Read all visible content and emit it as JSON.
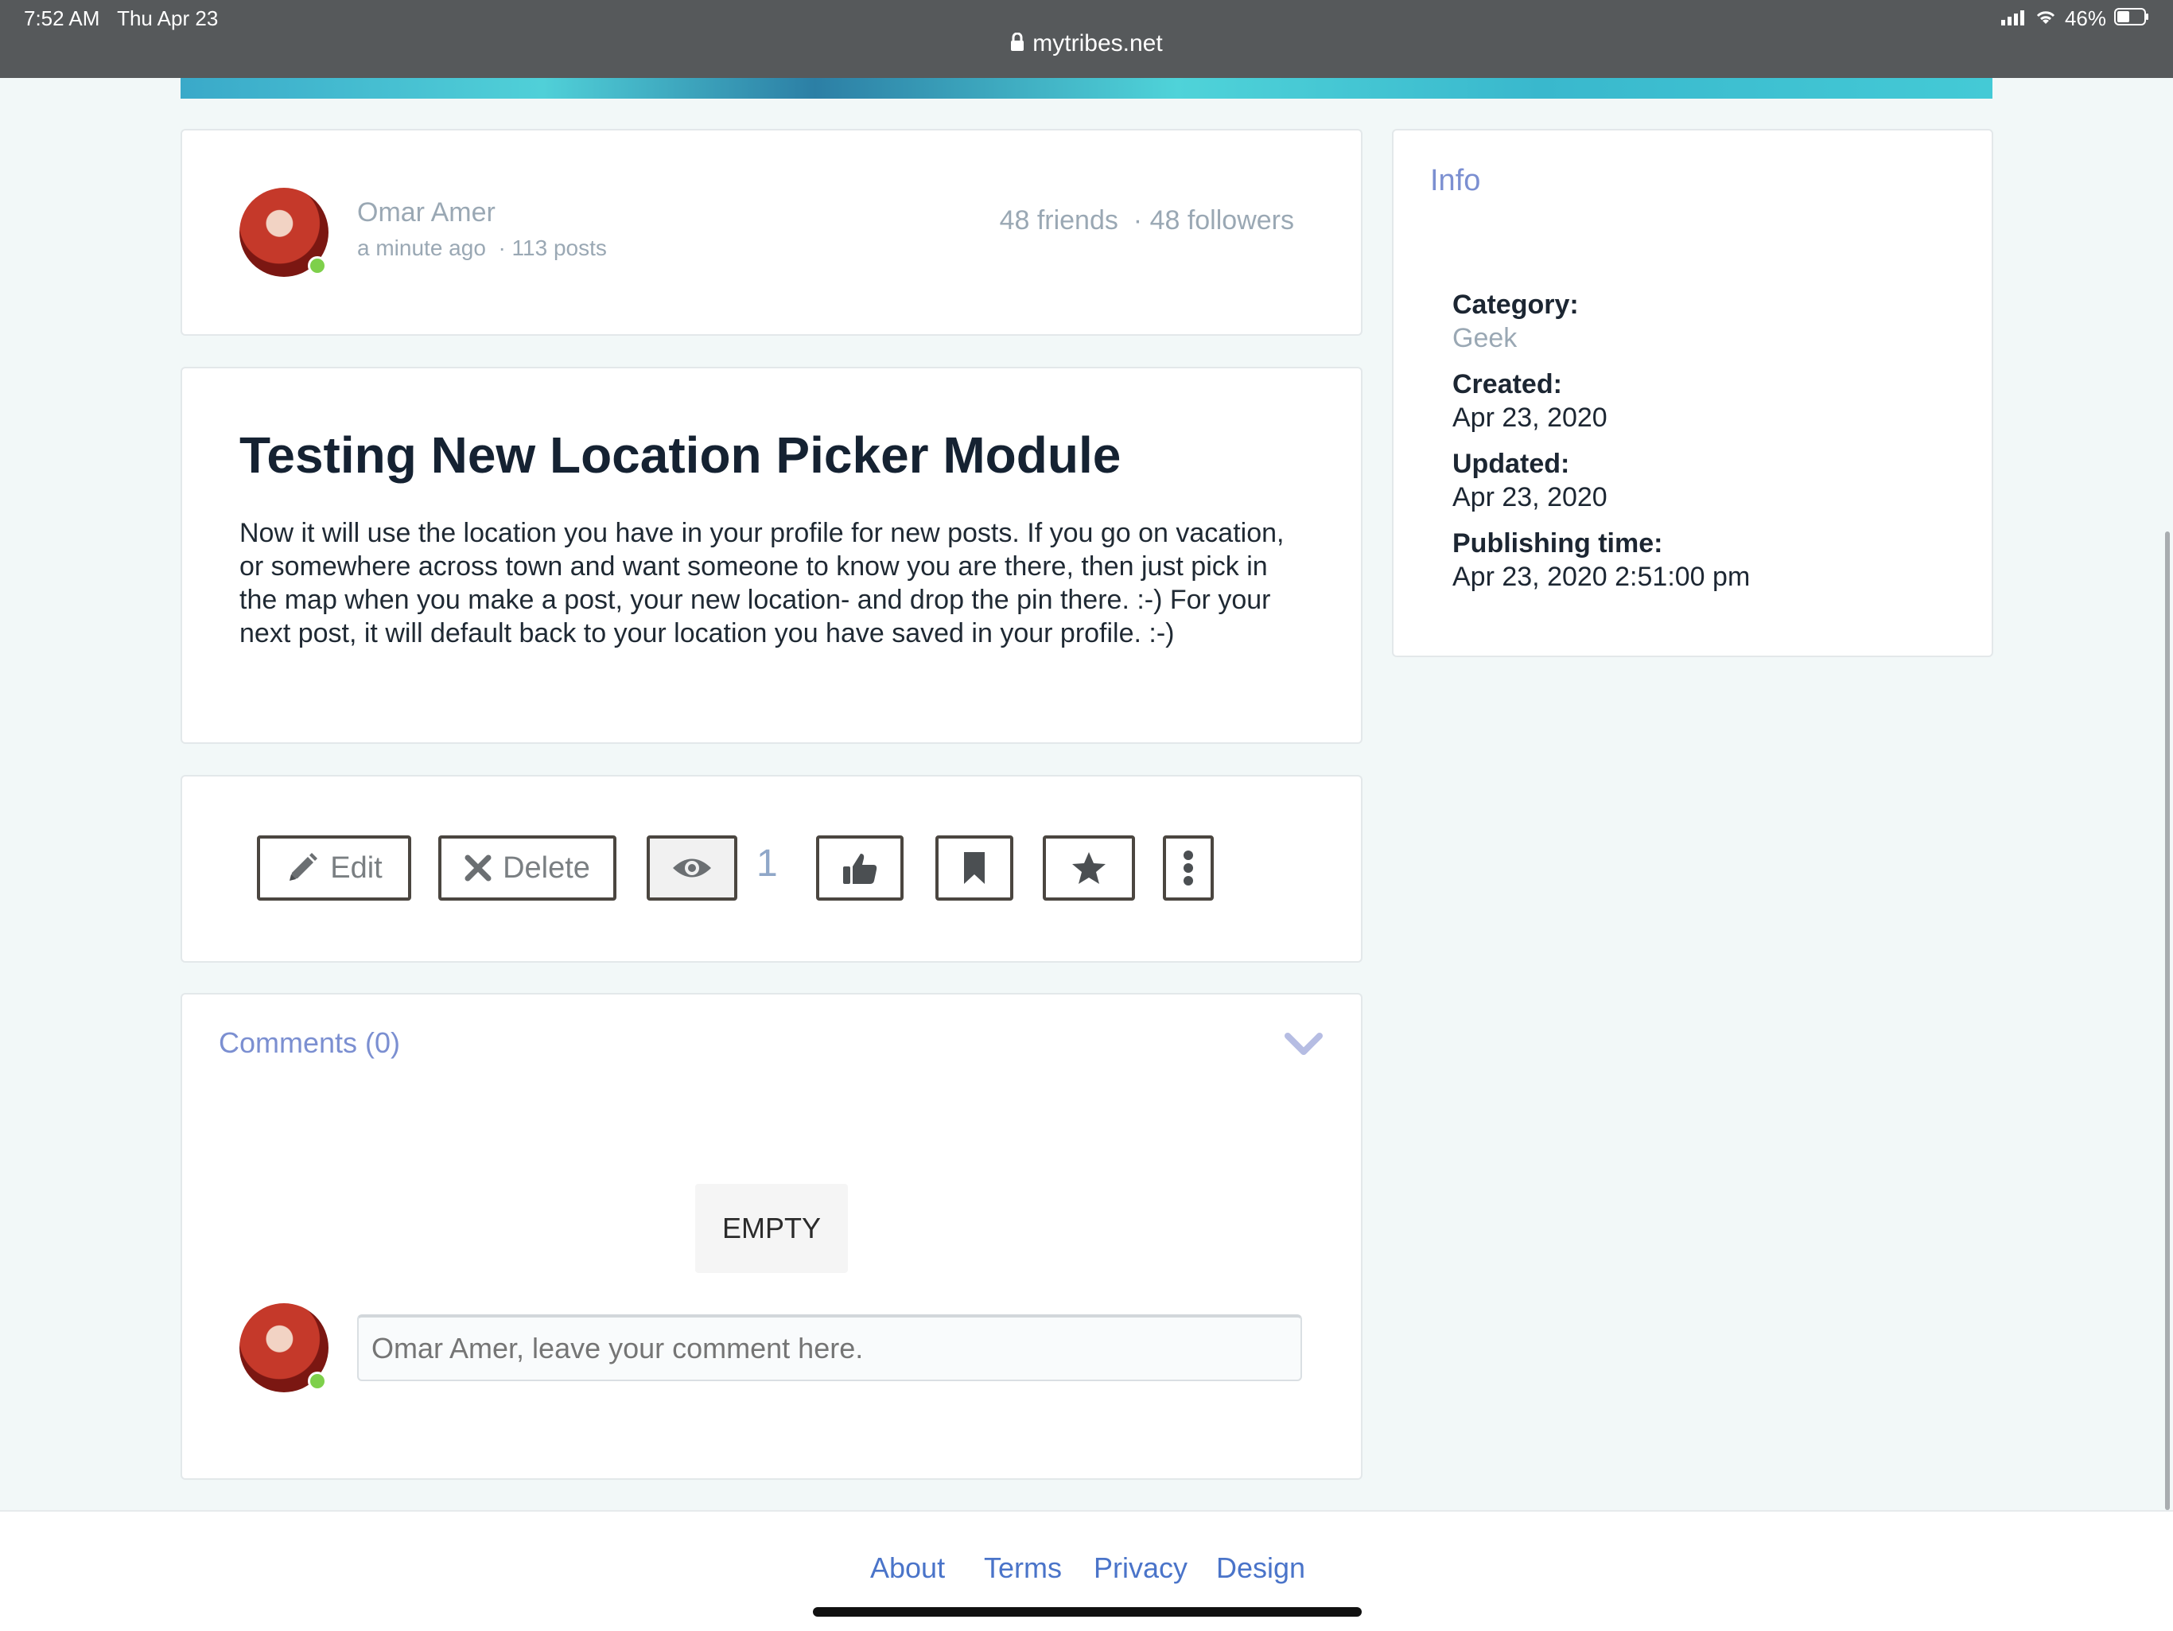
{
  "status_bar": {
    "time": "7:52 AM",
    "date": "Thu Apr 23",
    "url": "mytribes.net",
    "battery": "46%"
  },
  "author": {
    "name": "Omar Amer",
    "time_ago": "a minute ago",
    "posts": "· 113 posts",
    "friends": "48 friends",
    "followers": "· 48 followers"
  },
  "post": {
    "title": "Testing New Location Picker Module",
    "body": "Now it will use the location you have in your profile for new posts.  If you go on vacation, or somewhere across town and want someone to know you are there, then just pick in the map when you make a post, your new location- and drop the pin there.  :-)  For your next post, it will default back to your location you have saved in your profile.  :-)"
  },
  "actions": {
    "edit_label": "Edit",
    "delete_label": "Delete",
    "view_count": "1",
    "icons": [
      "pencil-icon",
      "close-icon",
      "eye-icon",
      "thumbs-up-icon",
      "bookmark-icon",
      "star-icon",
      "more-vertical-icon"
    ]
  },
  "comments": {
    "header": "Comments (0)",
    "empty_label": "EMPTY",
    "input_placeholder": "Omar Amer, leave your comment here."
  },
  "info": {
    "title": "Info",
    "category_label": "Category:",
    "category_value": "Geek",
    "created_label": "Created:",
    "created_value": "Apr 23, 2020",
    "updated_label": "Updated:",
    "updated_value": "Apr 23, 2020",
    "publishing_label": "Publishing time:",
    "publishing_value": "Apr 23, 2020 2:51:00 pm"
  },
  "footer": {
    "about": "About",
    "terms": "Terms",
    "privacy": "Privacy",
    "design": "Design"
  },
  "colors": {
    "accent": "#7b8fd1",
    "link": "#4a74c9",
    "online": "#7ed04b",
    "button_border": "#4b4640"
  }
}
